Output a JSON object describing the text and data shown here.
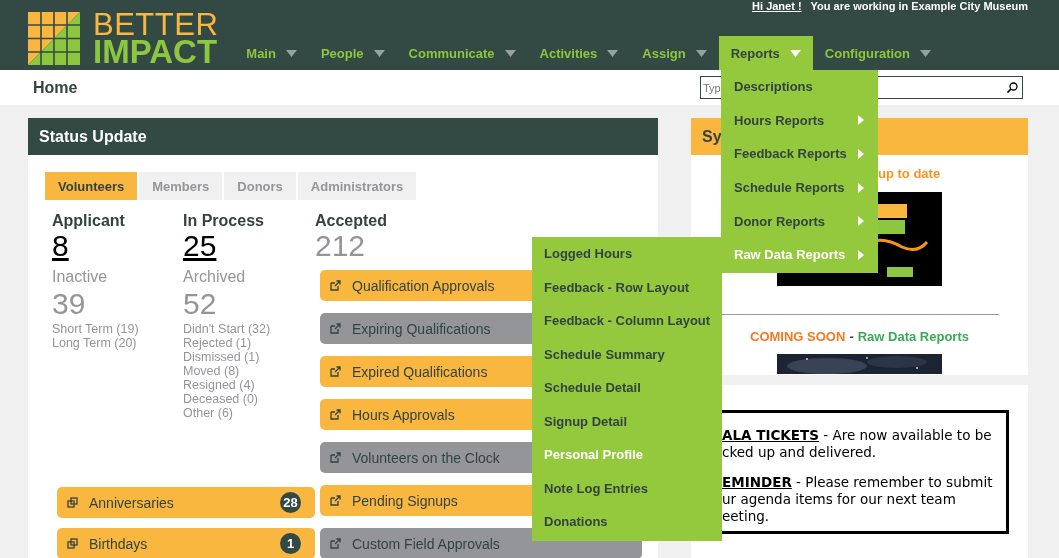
{
  "header": {
    "logo": {
      "line1": "BETTER",
      "line2": "IMPACT"
    },
    "greeting": "Hi Janet !",
    "workspace": "You are working in Example City Museum"
  },
  "nav": [
    {
      "label": "Main",
      "selected": false
    },
    {
      "label": "People",
      "selected": false
    },
    {
      "label": "Communicate",
      "selected": false
    },
    {
      "label": "Activities",
      "selected": false
    },
    {
      "label": "Assign",
      "selected": false
    },
    {
      "label": "Reports",
      "selected": true
    },
    {
      "label": "Configuration",
      "selected": false
    }
  ],
  "breadcrumb": "Home",
  "search": {
    "placeholder": "Typ"
  },
  "status_update": {
    "title": "Status Update",
    "tabs": [
      {
        "label": "Volunteers",
        "selected": true
      },
      {
        "label": "Members",
        "selected": false
      },
      {
        "label": "Donors",
        "selected": false
      },
      {
        "label": "Administrators",
        "selected": false
      }
    ],
    "stats": [
      {
        "label": "Applicant",
        "value": "8",
        "link": true,
        "sub_label": "Inactive",
        "sub_value": "39",
        "details": [
          "Short Term (19)",
          "Long Term (20)"
        ]
      },
      {
        "label": "In Process",
        "value": "25",
        "link": true,
        "sub_label": "Archived",
        "sub_value": "52",
        "details": [
          "Didn't Start (32)",
          "Rejected (1)",
          "Dismissed (1)",
          "Moved (8)",
          "Resigned (4)",
          "Deceased (0)",
          "Other (6)"
        ]
      }
    ],
    "accepted": {
      "label": "Accepted",
      "value": "212"
    },
    "actions": [
      {
        "label": "Qualification Approvals",
        "color": "#f9b740"
      },
      {
        "label": "Expiring Qualifications",
        "color": "#939598"
      },
      {
        "label": "Expired Qualifications",
        "color": "#f9b740"
      },
      {
        "label": "Hours Approvals",
        "color": "#f9b740"
      },
      {
        "label": "Volunteers on the Clock",
        "color": "#939598"
      },
      {
        "label": "Pending Signups",
        "color": "#f9b740"
      },
      {
        "label": "Custom Field Approvals",
        "color": "#939598"
      }
    ],
    "events": [
      {
        "label": "Anniversaries",
        "count": "28"
      },
      {
        "label": "Birthdays",
        "count": "1"
      }
    ]
  },
  "system_panel": {
    "title": "Sy",
    "subtitle": "up to date",
    "coming_soon": {
      "lead": "COMING SOON",
      "separator": "-",
      "tail": "Raw Data Reports"
    }
  },
  "notice": {
    "paragraphs": [
      [
        "**ALA TICKETS** - Are now available to be",
        "cked up and delivered."
      ],
      [
        "**EMINDER** - Please remember to submit",
        "ur agenda items for our next team",
        "eeting."
      ]
    ]
  },
  "reports_menu": {
    "items": [
      {
        "label": "Descriptions",
        "submenu": false,
        "selected": false
      },
      {
        "label": "Hours Reports",
        "submenu": true,
        "selected": false
      },
      {
        "label": "Feedback Reports",
        "submenu": true,
        "selected": false
      },
      {
        "label": "Schedule Reports",
        "submenu": true,
        "selected": false
      },
      {
        "label": "Donor Reports",
        "submenu": true,
        "selected": false
      },
      {
        "label": "Raw Data Reports",
        "submenu": true,
        "selected": true
      }
    ]
  },
  "raw_data_menu": {
    "items": [
      {
        "label": "Logged Hours",
        "selected": false
      },
      {
        "label": "Feedback - Row Layout",
        "selected": false
      },
      {
        "label": "Feedback - Column Layout",
        "selected": false
      },
      {
        "label": "Schedule Summary",
        "selected": false
      },
      {
        "label": "Schedule Detail",
        "selected": false
      },
      {
        "label": "Signup Detail",
        "selected": false
      },
      {
        "label": "Personal Profile",
        "selected": true
      },
      {
        "label": "Note Log Entries",
        "selected": false
      },
      {
        "label": "Donations",
        "selected": false
      }
    ]
  }
}
